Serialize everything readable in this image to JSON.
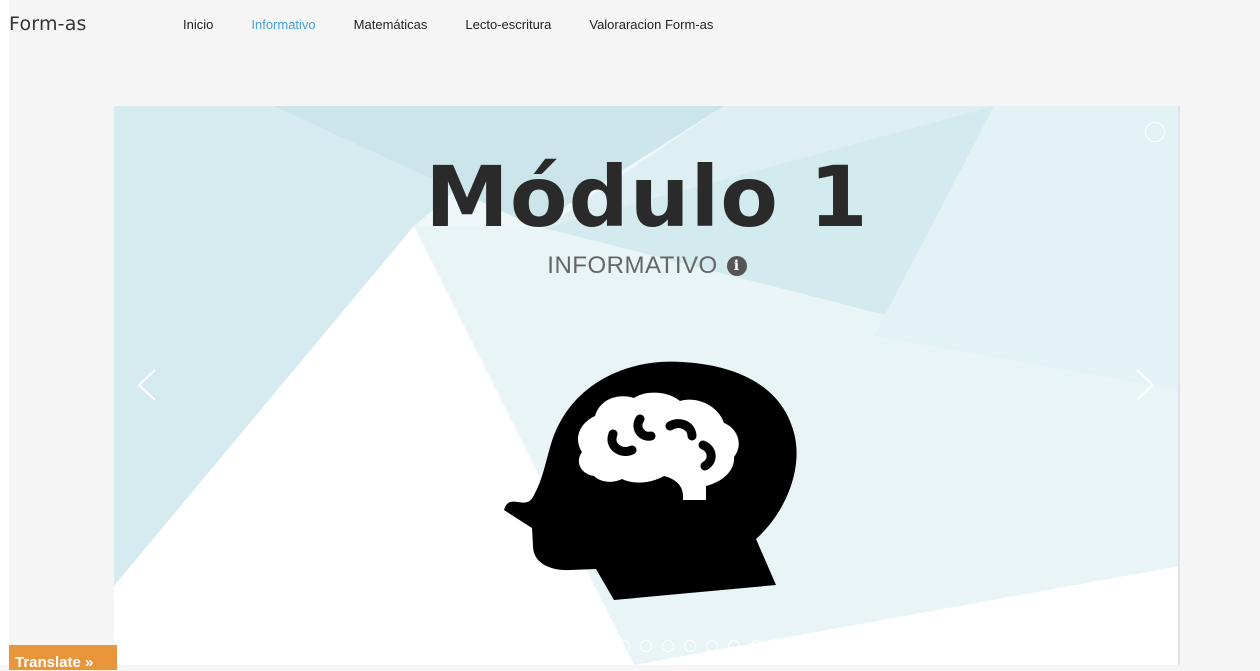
{
  "navbar": {
    "brand": "Form-as",
    "links": [
      {
        "label": "Inicio"
      },
      {
        "label": "Informativo"
      },
      {
        "label": "Matemáticas"
      },
      {
        "label": "Lecto-escritura"
      },
      {
        "label": "Valoraracion Form-as"
      }
    ],
    "active_link": "Informativo"
  },
  "slider": {
    "title": "Módulo 1",
    "subtitle": "INFORMATIVO",
    "illustration_icon": "head-brain-icon",
    "slide_count": 11,
    "active_slide": 1,
    "colors": {
      "light_blue": "#d5ebef",
      "pale_blue": "#e6f3f6",
      "white": "#ffffff",
      "icon": "#000000"
    }
  },
  "translate": {
    "label": "Translate »"
  },
  "colors": {
    "accent": "#4a9fd8",
    "translate_bg": "#e8953b",
    "page_bg": "#f5f5f5"
  }
}
